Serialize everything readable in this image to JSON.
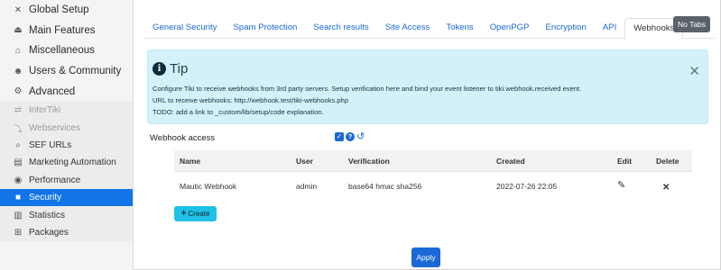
{
  "sidebar": {
    "items": [
      {
        "label": "Global Setup",
        "icon": "tools-icon",
        "glyph": "✕"
      },
      {
        "label": "Main Features",
        "icon": "institution-icon",
        "glyph": "⏏"
      },
      {
        "label": "Miscellaneous",
        "icon": "flask-icon",
        "glyph": "⌂"
      },
      {
        "label": "Users & Community",
        "icon": "users-icon",
        "glyph": "☻"
      },
      {
        "label": "Advanced",
        "icon": "cogs-icon",
        "glyph": "⚙"
      }
    ],
    "sub_items": [
      {
        "label": "InterTiki",
        "icon": "exchange-icon",
        "glyph": "⇄"
      },
      {
        "label": "Webservices",
        "icon": "webservices-icon",
        "glyph": "⤵"
      },
      {
        "label": "SEF URLs",
        "icon": "search-icon",
        "glyph": "⌕"
      },
      {
        "label": "Marketing Automation",
        "icon": "marketing-icon",
        "glyph": "▤"
      },
      {
        "label": "Performance",
        "icon": "performance-icon",
        "glyph": "◉"
      },
      {
        "label": "Security",
        "icon": "lock-icon",
        "glyph": "🔒"
      },
      {
        "label": "Statistics",
        "icon": "chart-icon",
        "glyph": "▥"
      },
      {
        "label": "Packages",
        "icon": "gift-icon",
        "glyph": "⊞"
      }
    ]
  },
  "tabs": [
    "General Security",
    "Spam Protection",
    "Search results",
    "Site Access",
    "Tokens",
    "OpenPGP",
    "Encryption",
    "API",
    "Webhooks"
  ],
  "active_tab": "Webhooks",
  "no_tabs_label": "No Tabs",
  "tip": {
    "title": "Tip",
    "close": "✕",
    "lines": [
      "Configure Tiki to receive webhooks from 3rd party servers. Setup verification here and bind your event listener to tiki.webhook.received event.",
      "URL to receive webhooks: http://webhook.test/tiki-webhooks.php",
      "TODO: add a link to _custom/lib/setup/code explanation."
    ]
  },
  "access": {
    "label": "Webhook access",
    "checked": true
  },
  "table": {
    "headers": [
      "Name",
      "User",
      "Verification",
      "Created",
      "Edit",
      "Delete"
    ],
    "rows": [
      {
        "name": "Mautic Webhook",
        "user": "admin",
        "verification": "base64 hmac sha256",
        "created": "2022-07-26 22:05"
      }
    ]
  },
  "buttons": {
    "create": "Create",
    "apply": "Apply"
  },
  "colors": {
    "accent": "#1174e8",
    "link": "#1b68d6",
    "tip_bg": "#d4f1f9",
    "create_btn": "#1fc1e8",
    "delete": "#e01010"
  }
}
